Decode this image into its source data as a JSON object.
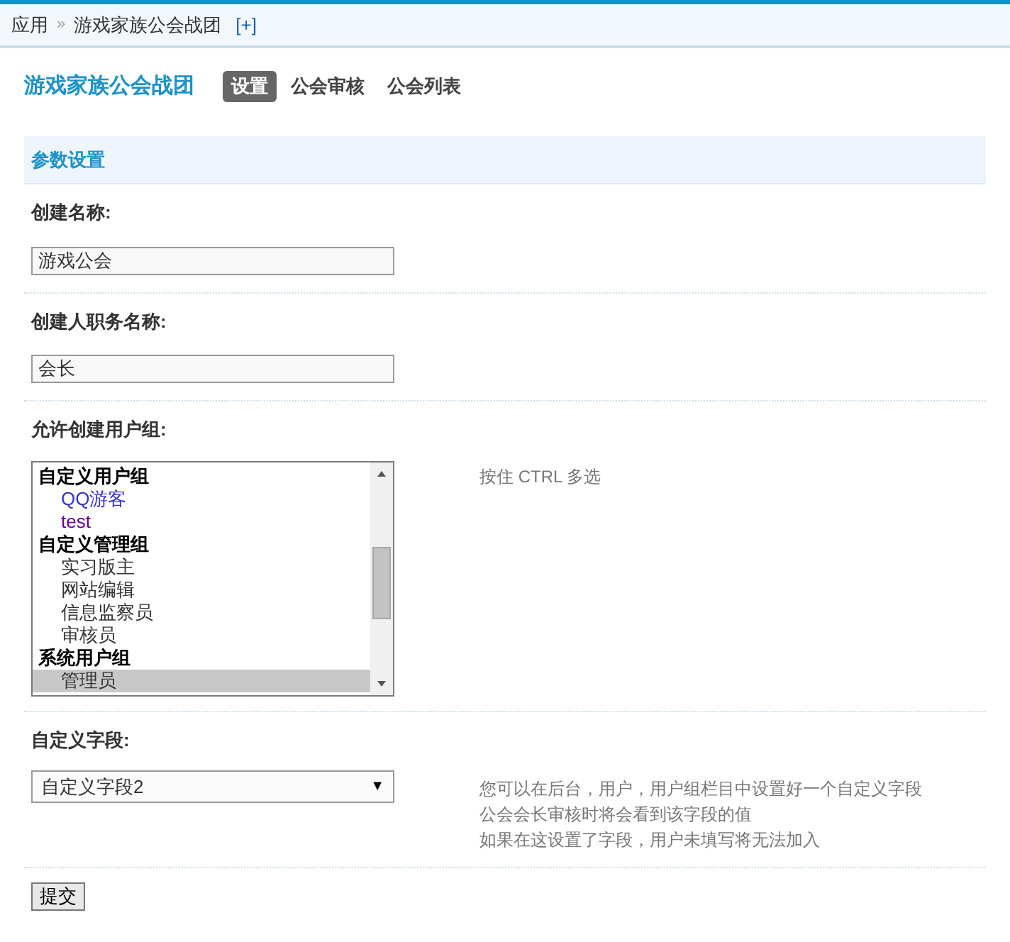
{
  "breadcrumb": {
    "root": "应用",
    "separator": "»",
    "current": "游戏家族公会战团",
    "add": "[+]"
  },
  "title": "游戏家族公会战团",
  "tabs": [
    {
      "label": "设置",
      "selected": true
    },
    {
      "label": "公会审核",
      "selected": false
    },
    {
      "label": "公会列表",
      "selected": false
    }
  ],
  "section": {
    "title": "参数设置"
  },
  "fields": [
    {
      "kind": "text",
      "label": "创建名称:",
      "value": "游戏公会"
    },
    {
      "kind": "text",
      "label": "创建人职务名称:",
      "value": "会长"
    },
    {
      "kind": "multiselect",
      "label": "允许创建用户组:",
      "hint": [
        "按住 CTRL 多选"
      ],
      "options": [
        {
          "kind": "group",
          "text": "自定义用户组"
        },
        {
          "kind": "option",
          "text": "QQ游客",
          "color": "#3333cc",
          "selected": false
        },
        {
          "kind": "option",
          "text": "test",
          "color": "#660099",
          "selected": false
        },
        {
          "kind": "group",
          "text": "自定义管理组"
        },
        {
          "kind": "option",
          "text": "实习版主",
          "color": "#333333",
          "selected": false
        },
        {
          "kind": "option",
          "text": "网站编辑",
          "color": "#333333",
          "selected": false
        },
        {
          "kind": "option",
          "text": "信息监察员",
          "color": "#333333",
          "selected": false
        },
        {
          "kind": "option",
          "text": "审核员",
          "color": "#333333",
          "selected": false
        },
        {
          "kind": "group",
          "text": "系统用户组"
        },
        {
          "kind": "option",
          "text": "管理员",
          "color": "#333333",
          "selected": true
        }
      ]
    },
    {
      "kind": "select",
      "label": "自定义字段:",
      "value": "自定义字段2",
      "arrow": "▼",
      "hint": [
        "您可以在后台，用户，用户组栏目中设置好一个自定义字段",
        "公会会长审核时将会看到该字段的值",
        "如果在这设置了字段，用户未填写将无法加入"
      ]
    }
  ],
  "submit": "提交"
}
